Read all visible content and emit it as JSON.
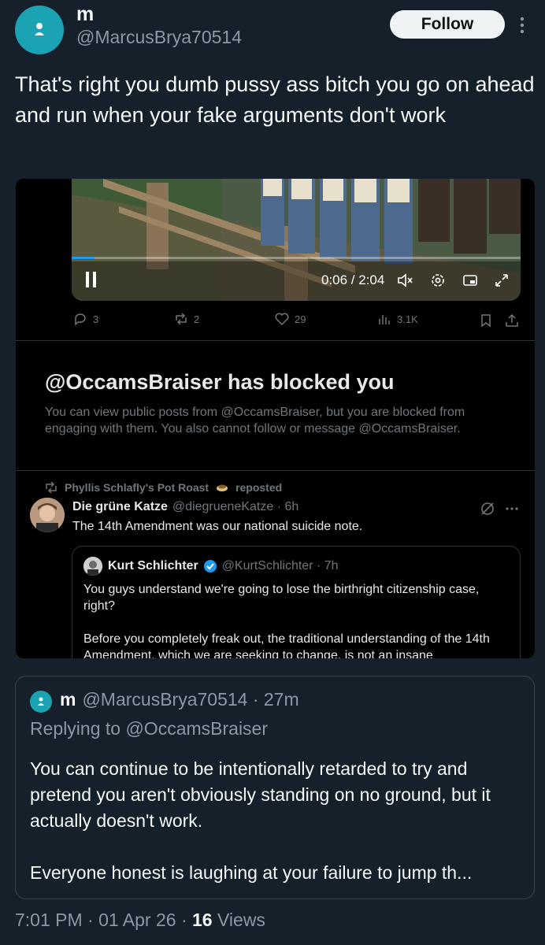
{
  "header": {
    "display_name": "m",
    "handle": "@MarcusBrya70514",
    "follow_label": "Follow"
  },
  "tweet": {
    "text": "That's right you dumb pussy ass bitch you go on ahead and run when your fake arguments don't work"
  },
  "embedded": {
    "video": {
      "time": "0:06 / 2:04",
      "progress": 0.05
    },
    "actions": {
      "replies": "3",
      "reposts": "2",
      "likes": "29",
      "views": "3.1K"
    },
    "blocked": {
      "title": "@OccamsBraiser has blocked you",
      "body": "You can view public posts from @OccamsBraiser, but you are blocked from engaging with them. You also cannot follow or message @OccamsBraiser."
    },
    "repost": {
      "reposted_by": "Phyllis Schlafly's Pot Roast",
      "reposted_suffix": "reposted",
      "author_name": "Die grüne Katze",
      "author_meta": "@diegrueneKatze · 6h",
      "text": "The 14th Amendment was our national suicide note."
    },
    "quote": {
      "author_name": "Kurt Schlichter",
      "author_meta": "@KurtSchlichter · 7h",
      "para1": "You guys understand we're going to lose the birthright citizenship case, right?",
      "para2": "Before you completely freak out, the traditional understanding of the 14th Amendment, which we are seeking to change, is not an insane"
    }
  },
  "reply": {
    "display_name": "m",
    "meta": "@MarcusBrya70514 · 27m",
    "replying_to": "Replying to @OccamsBraiser",
    "para1": "You can continue to be intentionally retarded to try and pretend you aren't obviously standing on no ground, but it actually doesn't work.",
    "para2": "Everyone honest is laughing at your failure to jump th..."
  },
  "footer": {
    "timestamp": "7:01 PM · 01 Apr 26 · ",
    "views_count": "16",
    "views_label": " Views"
  }
}
